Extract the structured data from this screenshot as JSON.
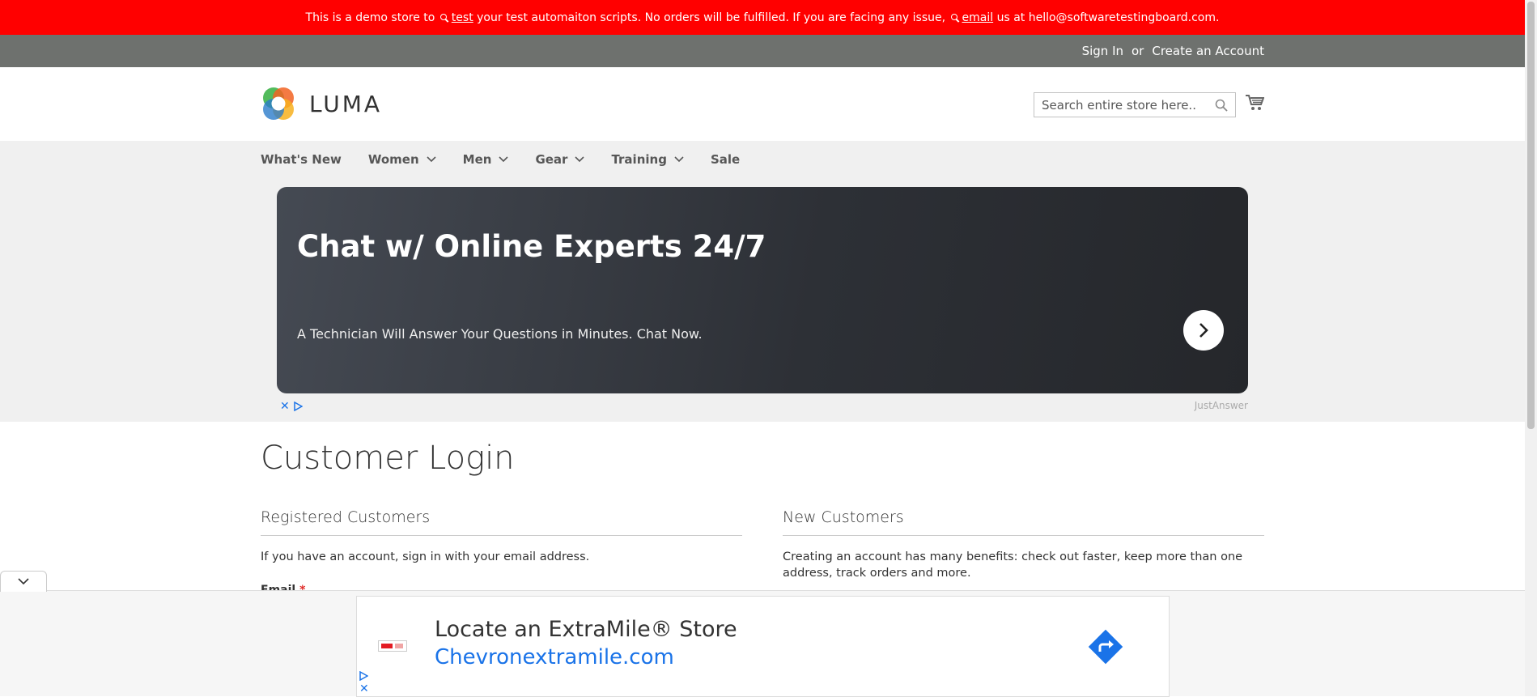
{
  "demo_notice": {
    "part1": "This is a demo store to",
    "link_test": "test",
    "part2": "your test automaiton scripts. No orders will be fulfilled. If you are facing any issue,",
    "link_email": "email",
    "part3": "us at hello@softwaretestingboard.com."
  },
  "header_links": {
    "sign_in": "Sign In",
    "or": "or",
    "create_account": "Create an Account"
  },
  "logo": {
    "text": "LUMA"
  },
  "search": {
    "placeholder": "Search entire store here..."
  },
  "nav": {
    "items": [
      "What's New",
      "Women",
      "Men",
      "Gear",
      "Training",
      "Sale"
    ]
  },
  "top_ad": {
    "title": "Chat w/ Online Experts 24/7",
    "subtitle": "A Technician Will Answer Your Questions in Minutes. Chat Now.",
    "brand": "JustAnswer"
  },
  "page": {
    "title": "Customer Login"
  },
  "registered": {
    "title": "Registered Customers",
    "text": "If you have an account, sign in with your email address.",
    "email_label": "Email",
    "required_mark": "*"
  },
  "new_customers": {
    "title": "New Customers",
    "text": "Creating an account has many benefits: check out faster, keep more than one address, track orders and more."
  },
  "bottom_ad": {
    "title": "Locate an ExtraMile® Store",
    "url": "Chevronextramile.com"
  },
  "colors": {
    "demo_bar": "#ff0000",
    "panel": "#6e716e",
    "nav_bg": "#f0f0f0",
    "ad_link": "#1a73e8"
  }
}
